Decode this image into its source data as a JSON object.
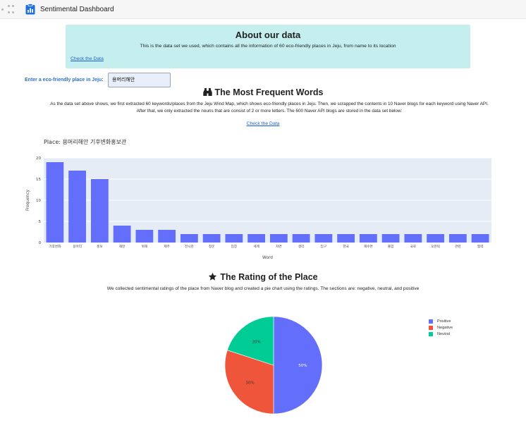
{
  "app": {
    "title": "Sentimental Dashboard",
    "icon": "clipboard-chart-icon"
  },
  "about": {
    "title": "About our data",
    "description": "This is the data set we used, which contains all the information of 60 eco-friendly places in Jeju, from name to its location",
    "link_label": "Check the Data"
  },
  "place_input": {
    "label": "Enter a eco-friendly place in Jeju:",
    "value": "용머리해안"
  },
  "frequent_words": {
    "heading": "The Most Frequent Words",
    "icon": "binoculars-icon",
    "description_line1": "As the data set above shows, we first extracted 60 keywords/places from the Jeju Wind Map, which shows eco-friendly places in Jeju. Then, we scrapped the contents in 10 Naver blogs for each keyword using Naver API.",
    "description_line2": "After that, we only extracted the nouns that are consist of 2 or more letters. The 600 Naver API blogs are stored in the data set below:",
    "link_label": "Check the Data"
  },
  "rating": {
    "heading": "The Rating of the Place",
    "icon": "star-icon",
    "description": "We collected sentimental ratings of the place from Naver blog and created a pie chart using the ratings. The sections are: negative, neutral, and positive"
  },
  "chart_data": [
    {
      "type": "bar",
      "title": "Place: 용머리해안 기후변화홍보관",
      "xlabel": "Word",
      "ylabel": "Frequency",
      "categories": [
        "기후변화",
        "용머리",
        "홍보",
        "해안",
        "위해",
        "제주",
        "전시관",
        "정문",
        "입장",
        "세계",
        "자연",
        "생각",
        "입구",
        "한국",
        "해수면",
        "출입",
        "국로",
        "오픈픽",
        "관련",
        "협력"
      ],
      "values": [
        19,
        17,
        15,
        4,
        3,
        3,
        2,
        2,
        2,
        2,
        2,
        2,
        2,
        2,
        2,
        2,
        2,
        2,
        2,
        2
      ],
      "ylim": [
        0,
        20
      ],
      "yticks": [
        0,
        5,
        10,
        15,
        20
      ],
      "grid": true,
      "bar_color": "#636efa",
      "plot_bg": "#e5ecf6"
    },
    {
      "type": "pie",
      "labels": [
        "Positive",
        "Negative",
        "Neutral"
      ],
      "values": [
        50,
        30,
        20
      ],
      "value_labels": [
        "50%",
        "30%",
        "20%"
      ],
      "colors": [
        "#636efa",
        "#ef553b",
        "#00cc96"
      ],
      "legend": "top-right"
    }
  ]
}
